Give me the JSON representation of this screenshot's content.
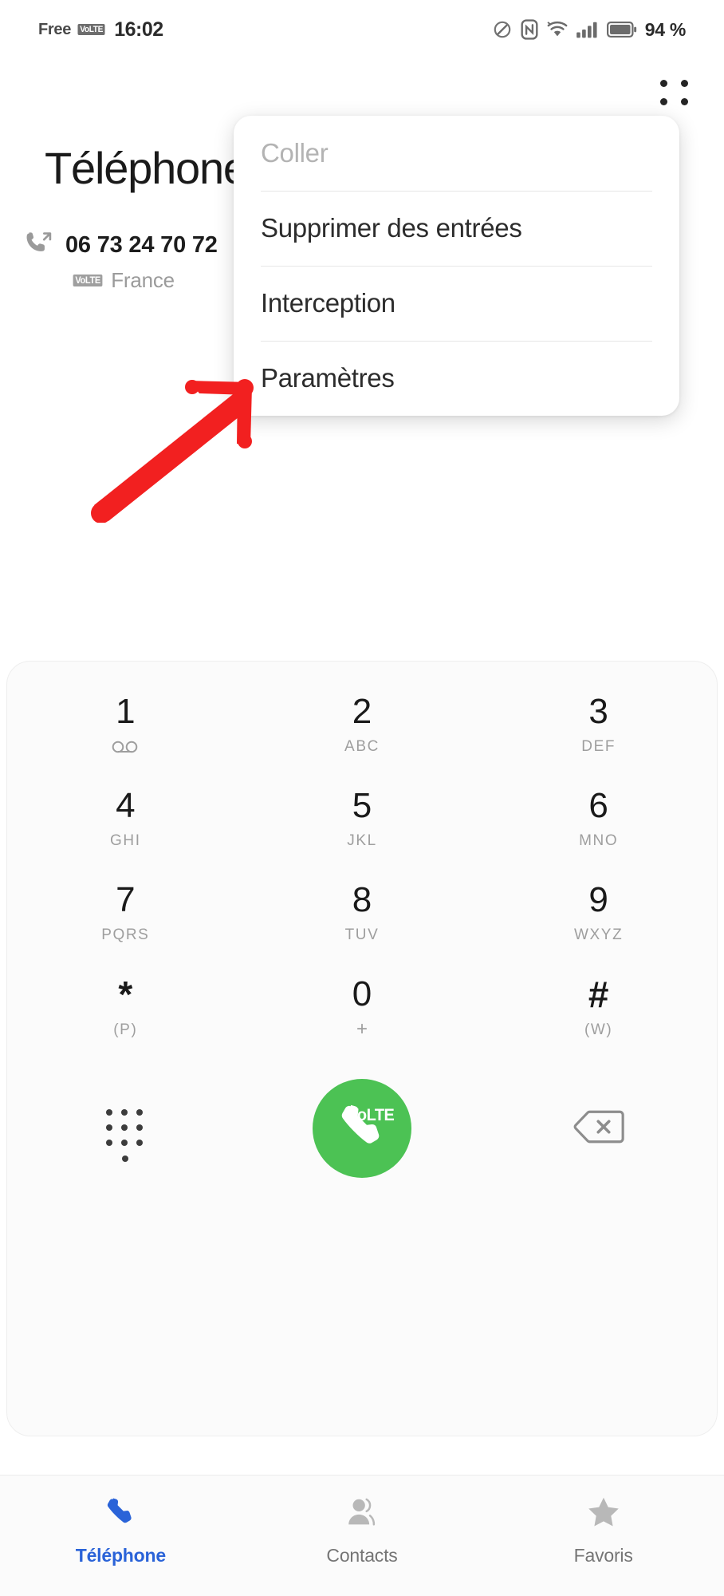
{
  "status_bar": {
    "carrier": "Free",
    "carrier_badge": "VoLTE",
    "time": "16:02",
    "battery_percent": "94 %",
    "icons": [
      "dnd-icon",
      "nfc-icon",
      "wifi-icon",
      "signal-icon",
      "battery-icon"
    ]
  },
  "header": {
    "title": "Téléphone",
    "overflow_icon": "more-options-icon"
  },
  "recent_call": {
    "call_type_icon": "outgoing-call-icon",
    "number": "06 73 24 70 72",
    "network_badge": "VoLTE",
    "country": "France"
  },
  "popup_menu": {
    "items": [
      {
        "label": "Coller",
        "disabled": true
      },
      {
        "label": "Supprimer des entrées",
        "disabled": false
      },
      {
        "label": "Interception",
        "disabled": false
      },
      {
        "label": "Paramètres",
        "disabled": false
      }
    ]
  },
  "annotation": {
    "type": "arrow",
    "color": "#f22020",
    "points_to": "Paramètres"
  },
  "dialpad": {
    "keys": [
      {
        "digit": "1",
        "sub": "",
        "icon": "voicemail-icon"
      },
      {
        "digit": "2",
        "sub": "ABC",
        "icon": ""
      },
      {
        "digit": "3",
        "sub": "DEF",
        "icon": ""
      },
      {
        "digit": "4",
        "sub": "GHI",
        "icon": ""
      },
      {
        "digit": "5",
        "sub": "JKL",
        "icon": ""
      },
      {
        "digit": "6",
        "sub": "MNO",
        "icon": ""
      },
      {
        "digit": "7",
        "sub": "PQRS",
        "icon": ""
      },
      {
        "digit": "8",
        "sub": "TUV",
        "icon": ""
      },
      {
        "digit": "9",
        "sub": "WXYZ",
        "icon": ""
      },
      {
        "digit": "*",
        "sub": "(P)",
        "icon": ""
      },
      {
        "digit": "0",
        "sub": "+",
        "icon": ""
      },
      {
        "digit": "#",
        "sub": "(W)",
        "icon": ""
      }
    ],
    "actions": {
      "hide_keypad_icon": "keypad-dots-icon",
      "call_label": "VoLTE",
      "call_icon": "phone-handset-icon",
      "call_color": "#4cc254",
      "backspace_icon": "backspace-icon"
    }
  },
  "bottom_nav": {
    "active_color": "#2a63d8",
    "items": [
      {
        "label": "Téléphone",
        "icon": "phone-icon",
        "active": true
      },
      {
        "label": "Contacts",
        "icon": "contacts-icon",
        "active": false
      },
      {
        "label": "Favoris",
        "icon": "star-icon",
        "active": false
      }
    ]
  }
}
